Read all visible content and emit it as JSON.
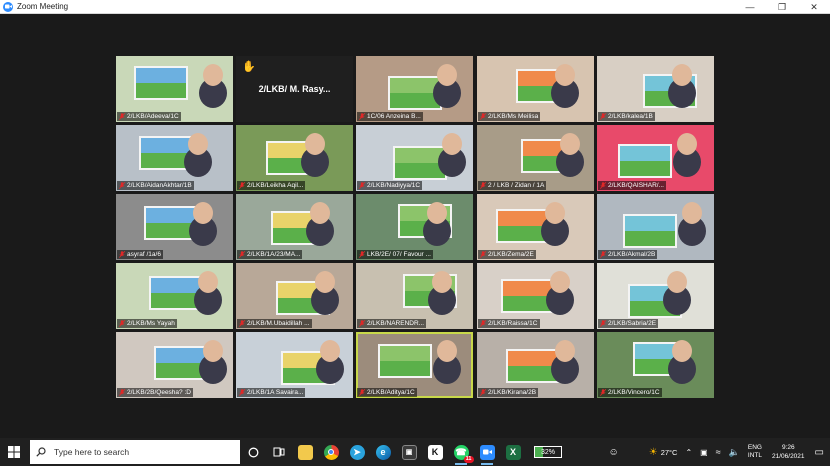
{
  "window": {
    "title": "Zoom Meeting"
  },
  "tiles": [
    {
      "label": "2/LKB/Adeeva/1C",
      "bg": "#c9d8b8"
    },
    {
      "label": "",
      "center_name": "2/LKB/ M. Rasy...",
      "raised_hand": true,
      "bg": "#1f1f1f"
    },
    {
      "label": "1C/06 Anzeina B...",
      "bg": "#b59b86"
    },
    {
      "label": "2/LKB/Ms Meilisa",
      "bg": "#d7c4b0"
    },
    {
      "label": "2/LKB/kalea/1B",
      "bg": "#d8cfc4"
    },
    {
      "label": "2/LKB/AidanAkhtar/1B",
      "bg": "#b8c0c8"
    },
    {
      "label": "2/LKB/Leikha Aqil...",
      "bg": "#7a9a58"
    },
    {
      "label": "2/LKB/Nadiyya/1C",
      "bg": "#c8cfd6"
    },
    {
      "label": "2 / LKB / Zidan / 1A",
      "bg": "#a89c88"
    },
    {
      "label": "2/LKB/QAISHAR/...",
      "bg": "#e84a6a"
    },
    {
      "label": "asyraf /1a/6",
      "bg": "#8c8c8c"
    },
    {
      "label": "2/LKB/1A/23/MA...",
      "bg": "#9aa89a"
    },
    {
      "label": "LKB/2E/ 07/ Favour ...",
      "bg": "#6c8c6c"
    },
    {
      "label": "2/LKB/Zema/2E",
      "bg": "#d9c9b9"
    },
    {
      "label": "2/LKB/Akmal/2B",
      "bg": "#b0b8c0"
    },
    {
      "label": "2/LKB/Ms Yayah",
      "bg": "#c9d8b8"
    },
    {
      "label": "2/LKB/M.Ubaidillah ...",
      "bg": "#b8a898"
    },
    {
      "label": "2/LKB/NARENDR...",
      "bg": "#c8c0b0"
    },
    {
      "label": "2/LKB/Raissa/1C",
      "bg": "#d8d0c8"
    },
    {
      "label": "2/LKB/Sabria/2E",
      "bg": "#e0e0d8"
    },
    {
      "label": "2/LKB/2B/Qeesha? :D",
      "bg": "#d0c8c0"
    },
    {
      "label": "2/LKB/1A Savaira...",
      "bg": "#c8d0d8"
    },
    {
      "label": "2/LKB/Aditya/1C",
      "bg": "#9c8c7c",
      "active": true
    },
    {
      "label": "2/LKB/Kirana/2B",
      "bg": "#b8b0a8"
    },
    {
      "label": "2/LKB/Vincero/1C",
      "bg": "#6a8c5a"
    }
  ],
  "taskbar": {
    "search_placeholder": "Type here to search",
    "battery_percent": "32%",
    "battery_level": 0.32,
    "weather": "27°C",
    "lang_top": "ENG",
    "lang_bottom": "INTL",
    "time": "9:26",
    "date": "21/06/2021",
    "notification_count": "11"
  }
}
